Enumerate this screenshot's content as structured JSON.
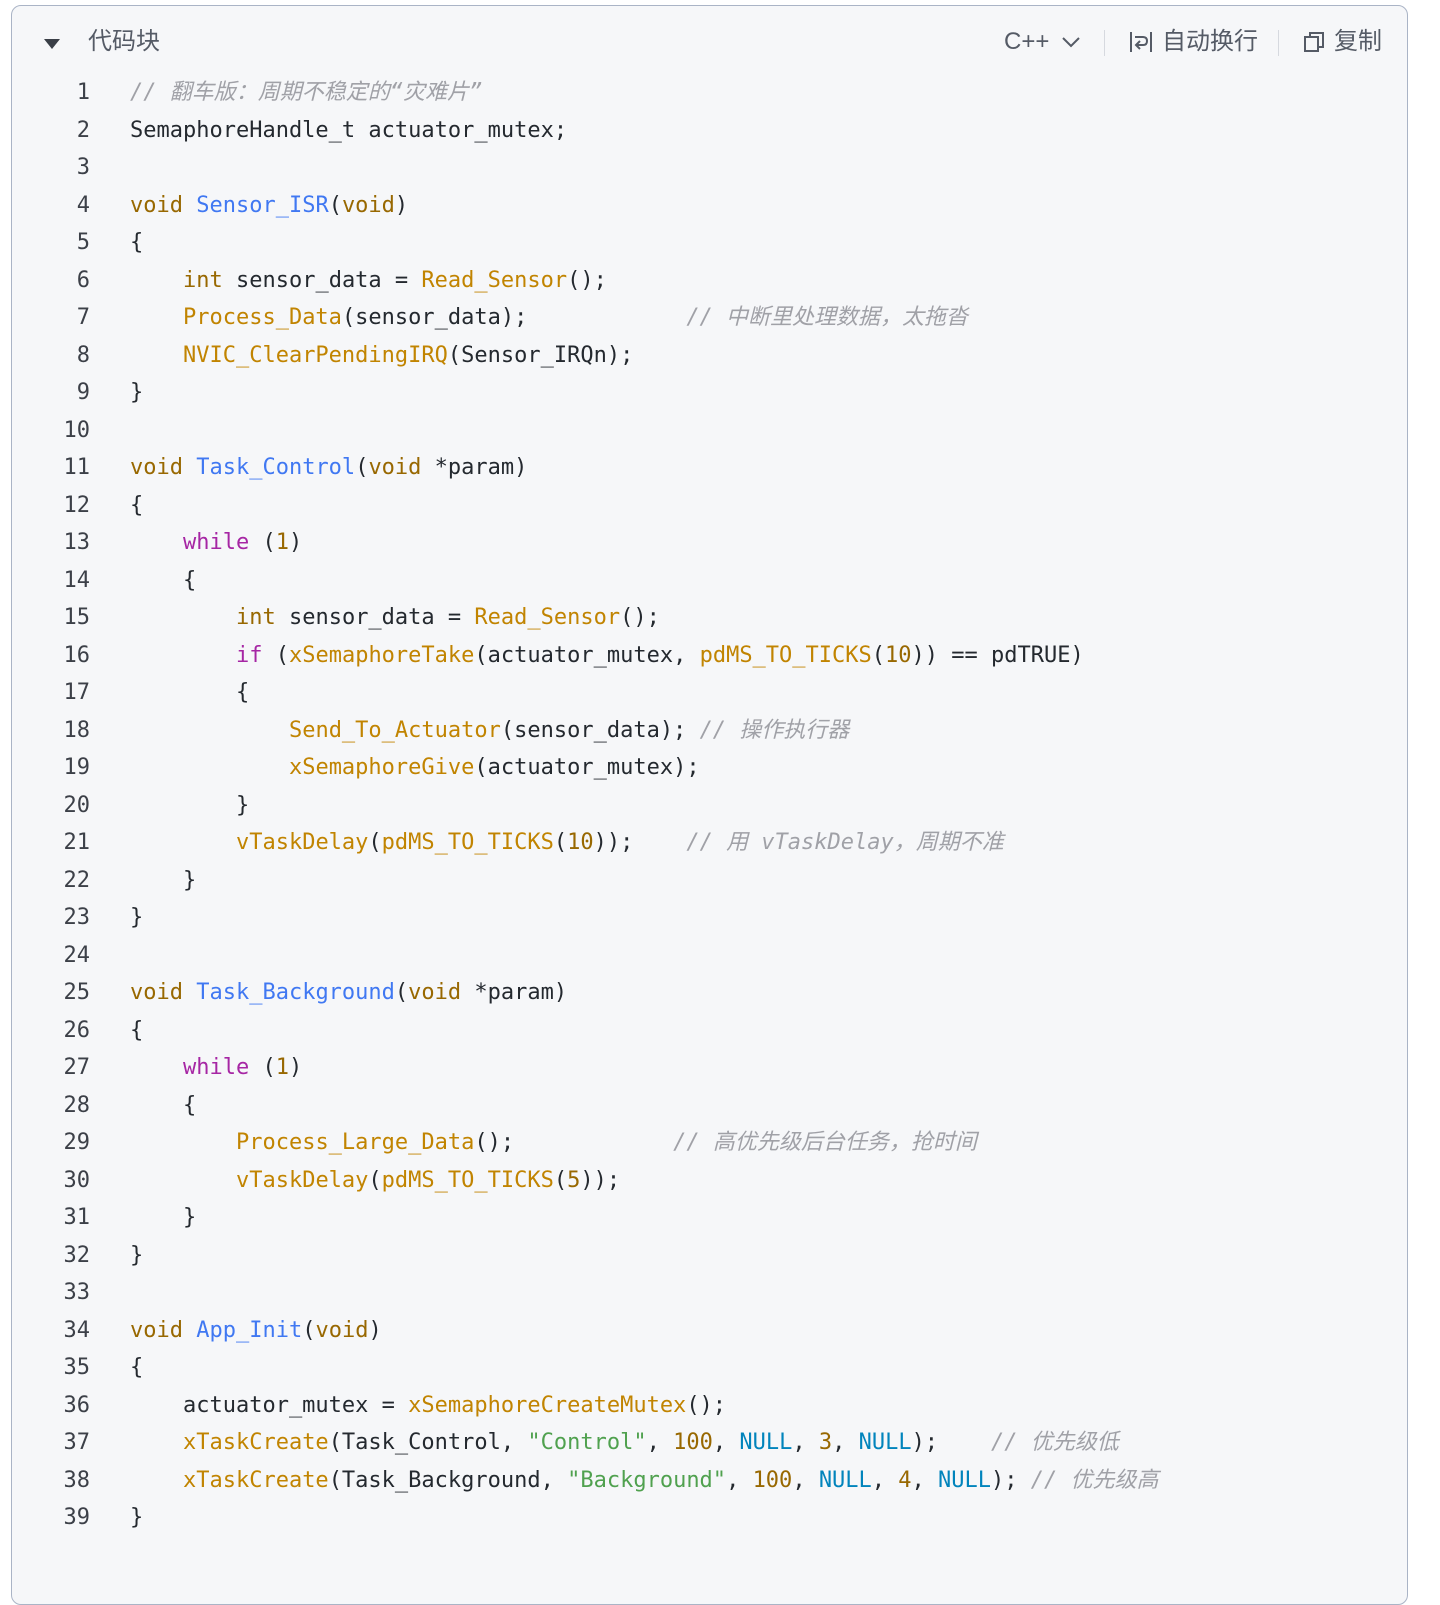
{
  "header": {
    "title": "代码块",
    "language": "C++",
    "wrap_label": "自动换行",
    "copy_label": "复制"
  },
  "colors": {
    "keyword": "#986801",
    "control": "#a626a4",
    "function_def": "#4078f2",
    "function_call": "#c18401",
    "string": "#50a14f",
    "number": "#986801",
    "constant": "#0184bc",
    "comment": "#a0a1a7",
    "plain": "#24292f"
  },
  "code": {
    "lines": [
      {
        "n": "1",
        "tokens": [
          {
            "t": "// 翻车版：周期不稳定的“灾难片”",
            "c": "cm"
          }
        ]
      },
      {
        "n": "2",
        "tokens": [
          {
            "t": "SemaphoreHandle_t actuator_mutex;",
            "c": "p"
          }
        ]
      },
      {
        "n": "3",
        "tokens": []
      },
      {
        "n": "4",
        "tokens": [
          {
            "t": "void",
            "c": "kw"
          },
          {
            "t": " ",
            "c": "p"
          },
          {
            "t": "Sensor_ISR",
            "c": "fn"
          },
          {
            "t": "(",
            "c": "p"
          },
          {
            "t": "void",
            "c": "kw"
          },
          {
            "t": ")",
            "c": "p"
          }
        ]
      },
      {
        "n": "5",
        "tokens": [
          {
            "t": "{",
            "c": "p"
          }
        ]
      },
      {
        "n": "6",
        "tokens": [
          {
            "t": "    ",
            "c": "p"
          },
          {
            "t": "int",
            "c": "kw"
          },
          {
            "t": " sensor_data = ",
            "c": "p"
          },
          {
            "t": "Read_Sensor",
            "c": "call"
          },
          {
            "t": "();",
            "c": "p"
          }
        ]
      },
      {
        "n": "7",
        "tokens": [
          {
            "t": "    ",
            "c": "p"
          },
          {
            "t": "Process_Data",
            "c": "call"
          },
          {
            "t": "(sensor_data);            ",
            "c": "p"
          },
          {
            "t": "// 中断里处理数据，太拖沓",
            "c": "cm"
          }
        ]
      },
      {
        "n": "8",
        "tokens": [
          {
            "t": "    ",
            "c": "p"
          },
          {
            "t": "NVIC_ClearPendingIRQ",
            "c": "call"
          },
          {
            "t": "(Sensor_IRQn);",
            "c": "p"
          }
        ]
      },
      {
        "n": "9",
        "tokens": [
          {
            "t": "}",
            "c": "p"
          }
        ]
      },
      {
        "n": "10",
        "tokens": []
      },
      {
        "n": "11",
        "tokens": [
          {
            "t": "void",
            "c": "kw"
          },
          {
            "t": " ",
            "c": "p"
          },
          {
            "t": "Task_Control",
            "c": "fn"
          },
          {
            "t": "(",
            "c": "p"
          },
          {
            "t": "void",
            "c": "kw"
          },
          {
            "t": " *param)",
            "c": "p"
          }
        ]
      },
      {
        "n": "12",
        "tokens": [
          {
            "t": "{",
            "c": "p"
          }
        ]
      },
      {
        "n": "13",
        "tokens": [
          {
            "t": "    ",
            "c": "p"
          },
          {
            "t": "while",
            "c": "ctl"
          },
          {
            "t": " (",
            "c": "p"
          },
          {
            "t": "1",
            "c": "num"
          },
          {
            "t": ")",
            "c": "p"
          }
        ]
      },
      {
        "n": "14",
        "tokens": [
          {
            "t": "    {",
            "c": "p"
          }
        ]
      },
      {
        "n": "15",
        "tokens": [
          {
            "t": "        ",
            "c": "p"
          },
          {
            "t": "int",
            "c": "kw"
          },
          {
            "t": " sensor_data = ",
            "c": "p"
          },
          {
            "t": "Read_Sensor",
            "c": "call"
          },
          {
            "t": "();",
            "c": "p"
          }
        ]
      },
      {
        "n": "16",
        "tokens": [
          {
            "t": "        ",
            "c": "p"
          },
          {
            "t": "if",
            "c": "ctl"
          },
          {
            "t": " (",
            "c": "p"
          },
          {
            "t": "xSemaphoreTake",
            "c": "call"
          },
          {
            "t": "(actuator_mutex, ",
            "c": "p"
          },
          {
            "t": "pdMS_TO_TICKS",
            "c": "call"
          },
          {
            "t": "(",
            "c": "p"
          },
          {
            "t": "10",
            "c": "num"
          },
          {
            "t": ")) == pdTRUE)",
            "c": "p"
          }
        ]
      },
      {
        "n": "17",
        "tokens": [
          {
            "t": "        {",
            "c": "p"
          }
        ]
      },
      {
        "n": "18",
        "tokens": [
          {
            "t": "            ",
            "c": "p"
          },
          {
            "t": "Send_To_Actuator",
            "c": "call"
          },
          {
            "t": "(sensor_data); ",
            "c": "p"
          },
          {
            "t": "// 操作执行器",
            "c": "cm"
          }
        ]
      },
      {
        "n": "19",
        "tokens": [
          {
            "t": "            ",
            "c": "p"
          },
          {
            "t": "xSemaphoreGive",
            "c": "call"
          },
          {
            "t": "(actuator_mutex);",
            "c": "p"
          }
        ]
      },
      {
        "n": "20",
        "tokens": [
          {
            "t": "        }",
            "c": "p"
          }
        ]
      },
      {
        "n": "21",
        "tokens": [
          {
            "t": "        ",
            "c": "p"
          },
          {
            "t": "vTaskDelay",
            "c": "call"
          },
          {
            "t": "(",
            "c": "p"
          },
          {
            "t": "pdMS_TO_TICKS",
            "c": "call"
          },
          {
            "t": "(",
            "c": "p"
          },
          {
            "t": "10",
            "c": "num"
          },
          {
            "t": "));    ",
            "c": "p"
          },
          {
            "t": "// 用 vTaskDelay，周期不准",
            "c": "cm"
          }
        ]
      },
      {
        "n": "22",
        "tokens": [
          {
            "t": "    }",
            "c": "p"
          }
        ]
      },
      {
        "n": "23",
        "tokens": [
          {
            "t": "}",
            "c": "p"
          }
        ]
      },
      {
        "n": "24",
        "tokens": []
      },
      {
        "n": "25",
        "tokens": [
          {
            "t": "void",
            "c": "kw"
          },
          {
            "t": " ",
            "c": "p"
          },
          {
            "t": "Task_Background",
            "c": "fn"
          },
          {
            "t": "(",
            "c": "p"
          },
          {
            "t": "void",
            "c": "kw"
          },
          {
            "t": " *param)",
            "c": "p"
          }
        ]
      },
      {
        "n": "26",
        "tokens": [
          {
            "t": "{",
            "c": "p"
          }
        ]
      },
      {
        "n": "27",
        "tokens": [
          {
            "t": "    ",
            "c": "p"
          },
          {
            "t": "while",
            "c": "ctl"
          },
          {
            "t": " (",
            "c": "p"
          },
          {
            "t": "1",
            "c": "num"
          },
          {
            "t": ")",
            "c": "p"
          }
        ]
      },
      {
        "n": "28",
        "tokens": [
          {
            "t": "    {",
            "c": "p"
          }
        ]
      },
      {
        "n": "29",
        "tokens": [
          {
            "t": "        ",
            "c": "p"
          },
          {
            "t": "Process_Large_Data",
            "c": "call"
          },
          {
            "t": "();            ",
            "c": "p"
          },
          {
            "t": "// 高优先级后台任务，抢时间",
            "c": "cm"
          }
        ]
      },
      {
        "n": "30",
        "tokens": [
          {
            "t": "        ",
            "c": "p"
          },
          {
            "t": "vTaskDelay",
            "c": "call"
          },
          {
            "t": "(",
            "c": "p"
          },
          {
            "t": "pdMS_TO_TICKS",
            "c": "call"
          },
          {
            "t": "(",
            "c": "p"
          },
          {
            "t": "5",
            "c": "num"
          },
          {
            "t": "));",
            "c": "p"
          }
        ]
      },
      {
        "n": "31",
        "tokens": [
          {
            "t": "    }",
            "c": "p"
          }
        ]
      },
      {
        "n": "32",
        "tokens": [
          {
            "t": "}",
            "c": "p"
          }
        ]
      },
      {
        "n": "33",
        "tokens": []
      },
      {
        "n": "34",
        "tokens": [
          {
            "t": "void",
            "c": "kw"
          },
          {
            "t": " ",
            "c": "p"
          },
          {
            "t": "App_Init",
            "c": "fn"
          },
          {
            "t": "(",
            "c": "p"
          },
          {
            "t": "void",
            "c": "kw"
          },
          {
            "t": ")",
            "c": "p"
          }
        ]
      },
      {
        "n": "35",
        "tokens": [
          {
            "t": "{",
            "c": "p"
          }
        ]
      },
      {
        "n": "36",
        "tokens": [
          {
            "t": "    actuator_mutex = ",
            "c": "p"
          },
          {
            "t": "xSemaphoreCreateMutex",
            "c": "call"
          },
          {
            "t": "();",
            "c": "p"
          }
        ]
      },
      {
        "n": "37",
        "tokens": [
          {
            "t": "    ",
            "c": "p"
          },
          {
            "t": "xTaskCreate",
            "c": "call"
          },
          {
            "t": "(Task_Control, ",
            "c": "p"
          },
          {
            "t": "\"Control\"",
            "c": "str"
          },
          {
            "t": ", ",
            "c": "p"
          },
          {
            "t": "100",
            "c": "num"
          },
          {
            "t": ", ",
            "c": "p"
          },
          {
            "t": "NULL",
            "c": "cst"
          },
          {
            "t": ", ",
            "c": "p"
          },
          {
            "t": "3",
            "c": "num"
          },
          {
            "t": ", ",
            "c": "p"
          },
          {
            "t": "NULL",
            "c": "cst"
          },
          {
            "t": ");    ",
            "c": "p"
          },
          {
            "t": "// 优先级低",
            "c": "cm"
          }
        ]
      },
      {
        "n": "38",
        "tokens": [
          {
            "t": "    ",
            "c": "p"
          },
          {
            "t": "xTaskCreate",
            "c": "call"
          },
          {
            "t": "(Task_Background, ",
            "c": "p"
          },
          {
            "t": "\"Background\"",
            "c": "str"
          },
          {
            "t": ", ",
            "c": "p"
          },
          {
            "t": "100",
            "c": "num"
          },
          {
            "t": ", ",
            "c": "p"
          },
          {
            "t": "NULL",
            "c": "cst"
          },
          {
            "t": ", ",
            "c": "p"
          },
          {
            "t": "4",
            "c": "num"
          },
          {
            "t": ", ",
            "c": "p"
          },
          {
            "t": "NULL",
            "c": "cst"
          },
          {
            "t": "); ",
            "c": "p"
          },
          {
            "t": "// 优先级高",
            "c": "cm"
          }
        ]
      },
      {
        "n": "39",
        "tokens": [
          {
            "t": "}",
            "c": "p"
          }
        ]
      }
    ]
  }
}
